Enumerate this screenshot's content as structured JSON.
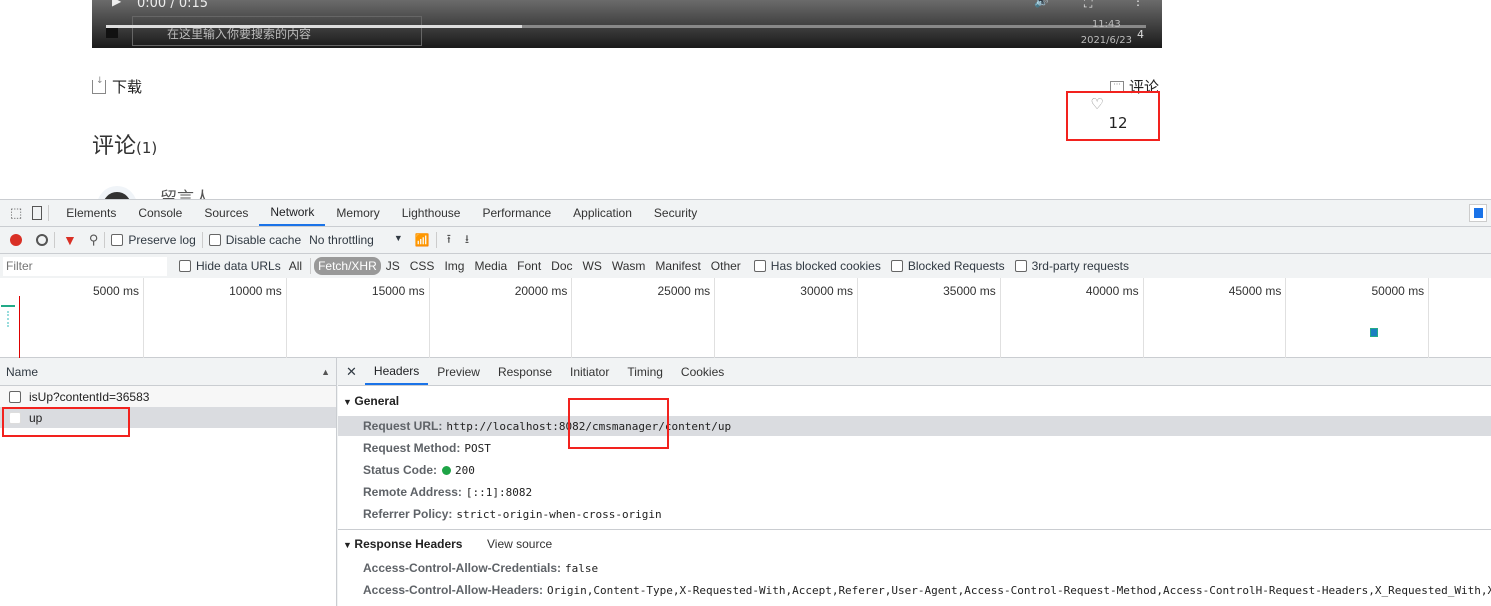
{
  "video": {
    "time": "0:00 / 0:15",
    "progress_percent": 40,
    "taskbar_search": "在这里输入你要搜索的内容",
    "clock_time": "11:43",
    "clock_date": "2021/6/23",
    "notification_count": "4"
  },
  "page": {
    "download_label": "下载",
    "comment_label": "评论",
    "like_count": "12",
    "comments_title": "评论",
    "comments_count": "(1)",
    "commenter": "留言人"
  },
  "devtools": {
    "tabs": [
      "Elements",
      "Console",
      "Sources",
      "Network",
      "Memory",
      "Lighthouse",
      "Performance",
      "Application",
      "Security"
    ],
    "active_tab": "Network",
    "toolbar": {
      "preserve_log": "Preserve log",
      "disable_cache": "Disable cache",
      "throttling": "No throttling"
    },
    "filter": {
      "placeholder": "Filter",
      "hide_data_urls": "Hide data URLs",
      "types": [
        "All",
        "Fetch/XHR",
        "JS",
        "CSS",
        "Img",
        "Media",
        "Font",
        "Doc",
        "WS",
        "Wasm",
        "Manifest",
        "Other"
      ],
      "selected_type": "Fetch/XHR",
      "has_blocked_cookies": "Has blocked cookies",
      "blocked_requests": "Blocked Requests",
      "third_party": "3rd-party requests"
    },
    "timeline_ticks": [
      "5000 ms",
      "10000 ms",
      "15000 ms",
      "20000 ms",
      "25000 ms",
      "30000 ms",
      "35000 ms",
      "40000 ms",
      "45000 ms",
      "50000 ms"
    ],
    "requests_header": "Name",
    "requests": [
      "isUp?contentId=36583",
      "up"
    ],
    "selected_request": "up",
    "detail_tabs": [
      "Headers",
      "Preview",
      "Response",
      "Initiator",
      "Timing",
      "Cookies"
    ],
    "active_detail_tab": "Headers",
    "general": {
      "title": "General",
      "items": [
        {
          "key": "Request URL:",
          "value": "http://localhost:8082/cmsmanager/content/up"
        },
        {
          "key": "Request Method:",
          "value": "POST"
        },
        {
          "key": "Status Code:",
          "value": "200",
          "status_color": "#1ea446"
        },
        {
          "key": "Remote Address:",
          "value": "[::1]:8082"
        },
        {
          "key": "Referrer Policy:",
          "value": "strict-origin-when-cross-origin"
        }
      ]
    },
    "response_headers": {
      "title": "Response Headers",
      "view_source": "View source",
      "items": [
        {
          "key": "Access-Control-Allow-Credentials:",
          "value": "false"
        },
        {
          "key": "Access-Control-Allow-Headers:",
          "value": "Origin,Content-Type,X-Requested-With,Accept,Referer,User-Agent,Access-Control-Request-Method,Access-ControlH-Request-Headers,X_Requested_With,X-"
        }
      ]
    }
  },
  "colors": {
    "accent": "#1a73e8",
    "record": "#d93025",
    "highlight_box": "#f2221e"
  }
}
